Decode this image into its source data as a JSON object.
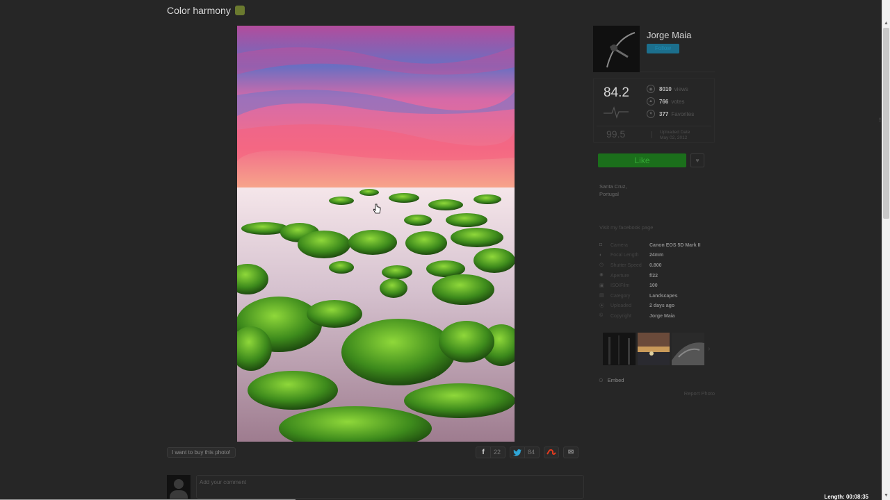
{
  "photo": {
    "title": "Color harmony",
    "alt": "Mossy rocks on a misty shore under a pink and blue sunset sky"
  },
  "actions": {
    "buy_label": "I want to buy this photo!",
    "share": [
      {
        "network": "facebook",
        "icon": "facebook-icon",
        "glyph": "f",
        "count": "22"
      },
      {
        "network": "twitter",
        "icon": "twitter-icon",
        "glyph": "t",
        "count": "84"
      },
      {
        "network": "stumbleupon",
        "icon": "stumbleupon-icon",
        "glyph": "S",
        "count": ""
      },
      {
        "network": "email",
        "icon": "mail-icon",
        "glyph": "✉",
        "count": ""
      }
    ]
  },
  "comment": {
    "placeholder": "Add your comment"
  },
  "author": {
    "name": "Jorge Maia",
    "follow_label": "Follow"
  },
  "stats": {
    "pulse": "84.2",
    "views_count": "8010",
    "views_label": "views",
    "votes_count": "766",
    "votes_label": "votes",
    "favorites_count": "377",
    "favorites_label": "Favorites",
    "highest_pulse": "99.5",
    "uploaded_label": "Uploaded Date",
    "uploaded_date": "May 02, 2012"
  },
  "like": {
    "label": "Like"
  },
  "location": {
    "line1": "Santa Cruz,",
    "line2": "Portugal"
  },
  "facebook_link": "Visit my facebook page",
  "details": [
    {
      "icon": "camera-icon",
      "glyph": "◘",
      "label": "Camera",
      "value": "Canon EOS 5D Mark II"
    },
    {
      "icon": "lens-icon",
      "glyph": "◐",
      "label": "Focal Length",
      "value": "24mm"
    },
    {
      "icon": "shutter-icon",
      "glyph": "◷",
      "label": "Shutter Speed",
      "value": "0.800"
    },
    {
      "icon": "aperture-icon",
      "glyph": "✺",
      "label": "Aperture",
      "value": "f/22"
    },
    {
      "icon": "iso-icon",
      "glyph": "▣",
      "label": "ISO/Film",
      "value": "100"
    },
    {
      "icon": "category-icon",
      "glyph": "▤",
      "label": "Category",
      "value": "Landscapes"
    },
    {
      "icon": "clock-icon",
      "glyph": "⦿",
      "label": "Uploaded",
      "value": "2 days ago"
    },
    {
      "icon": "copyright-icon",
      "glyph": "©",
      "label": "Copyright",
      "value": "Jorge Maia"
    }
  ],
  "embed_label": "Embed",
  "report_label": "Report Photo",
  "video": {
    "length": "Length: 00:08:35"
  },
  "colors": {
    "background": "#262626",
    "like_green": "#1b6f1b",
    "follow_blue": "#1c6f8d"
  }
}
